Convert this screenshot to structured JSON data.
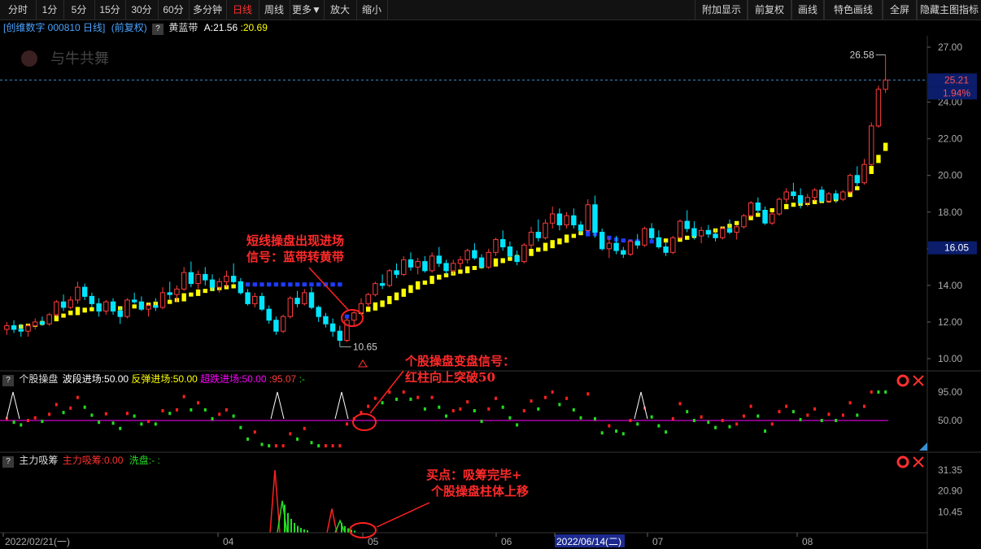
{
  "toolbar": {
    "items": [
      "分时",
      "1分",
      "5分",
      "15分",
      "30分",
      "60分",
      "多分钟",
      "日线",
      "周线",
      "更多▼",
      "放大",
      "缩小"
    ],
    "active": "日线",
    "right": [
      "附加显示",
      "前复权",
      "画线",
      "特色画线",
      "全屏",
      "隐藏主图指标"
    ]
  },
  "header": {
    "stock": "[创维数字 000810 日线]",
    "adj": "(前复权)",
    "q": "?",
    "indicator": "黄蓝带",
    "a_label": "A:21.56",
    "a2": ":20.69"
  },
  "logo": "与牛共舞",
  "main_axis": [
    "27.00",
    "24.00",
    "22.00",
    "20.00",
    "18.00",
    "16.00",
    "14.00",
    "12.00",
    "10.00"
  ],
  "price_tags": {
    "last": "25.21",
    "pct": "1.94%",
    "cross": "16.05",
    "high": "26.58",
    "low": "10.65"
  },
  "sub1": {
    "q": "?",
    "name": "个股操盘",
    "l1": "波段进场:50.00",
    "l2": "反弹进场:50.00",
    "l3": "超跌进场:50.00",
    "l4": ":95.07",
    "l5": ":-",
    "axis": [
      "95.00",
      "50.00"
    ]
  },
  "sub2": {
    "q": "?",
    "name": "主力吸筹",
    "l1": "主力吸筹:0.00",
    "l2": "洗盘:-",
    "l3": ":",
    "axis": [
      "31.35",
      "20.90",
      "10.45"
    ]
  },
  "dates": [
    "2022/02/21(一)",
    "04",
    "05",
    "06",
    "2022/06/14(二)",
    "07",
    "08"
  ],
  "annotations": {
    "a1": [
      "短线操盘出现进场",
      "信号：蓝带转黄带"
    ],
    "a2": [
      "个股操盘变盘信号：",
      "红柱向上突破50"
    ],
    "a3": [
      "买点：吸筹完毕+",
      "个股操盘柱体上移"
    ]
  },
  "colors": {
    "up": "#ff3c3c",
    "down": "#00e5ff",
    "yellow": "#ffff00",
    "blue": "#1f3cff",
    "magenta": "#ff00ff",
    "green": "#22dd22",
    "red": "#ff2020"
  },
  "chart_data": {
    "type": "candlestick",
    "ylim": [
      9.5,
      27.5
    ],
    "ohlc": [
      [
        11.6,
        12.0,
        11.3,
        11.8
      ],
      [
        11.8,
        12.1,
        11.4,
        11.6
      ],
      [
        11.6,
        11.9,
        11.2,
        11.5
      ],
      [
        11.5,
        11.9,
        11.2,
        11.8
      ],
      [
        11.8,
        12.2,
        11.6,
        12.0
      ],
      [
        12.0,
        12.3,
        11.8,
        11.9
      ],
      [
        11.9,
        12.5,
        11.8,
        12.4
      ],
      [
        12.4,
        13.2,
        12.3,
        13.1
      ],
      [
        13.1,
        13.5,
        12.6,
        12.8
      ],
      [
        12.8,
        13.4,
        12.7,
        13.2
      ],
      [
        13.2,
        14.2,
        13.0,
        13.9
      ],
      [
        13.9,
        14.1,
        13.2,
        13.4
      ],
      [
        13.4,
        13.6,
        12.8,
        13.0
      ],
      [
        13.0,
        13.3,
        12.3,
        12.6
      ],
      [
        12.6,
        13.2,
        12.4,
        13.1
      ],
      [
        13.1,
        13.3,
        12.4,
        12.6
      ],
      [
        12.6,
        12.8,
        11.9,
        12.3
      ],
      [
        12.3,
        13.3,
        12.2,
        13.2
      ],
      [
        13.2,
        13.6,
        13.0,
        13.1
      ],
      [
        13.1,
        13.4,
        12.6,
        12.7
      ],
      [
        12.7,
        13.0,
        12.3,
        12.9
      ],
      [
        12.9,
        13.3,
        12.6,
        12.8
      ],
      [
        12.8,
        13.9,
        12.7,
        13.6
      ],
      [
        13.6,
        14.2,
        13.2,
        13.5
      ],
      [
        13.5,
        14.0,
        13.1,
        13.8
      ],
      [
        13.8,
        15.0,
        13.7,
        14.7
      ],
      [
        14.7,
        15.3,
        13.9,
        14.1
      ],
      [
        14.1,
        14.8,
        13.8,
        14.6
      ],
      [
        14.6,
        15.0,
        14.0,
        14.3
      ],
      [
        14.3,
        14.6,
        13.7,
        13.9
      ],
      [
        13.9,
        14.4,
        13.6,
        14.2
      ],
      [
        14.2,
        14.8,
        13.9,
        14.5
      ],
      [
        14.5,
        15.2,
        14.1,
        14.2
      ],
      [
        14.2,
        14.4,
        13.5,
        13.6
      ],
      [
        13.6,
        13.8,
        12.9,
        13.0
      ],
      [
        13.0,
        13.6,
        12.8,
        13.4
      ],
      [
        13.4,
        13.6,
        12.6,
        12.7
      ],
      [
        12.7,
        12.9,
        11.9,
        12.1
      ],
      [
        12.1,
        12.3,
        11.3,
        11.5
      ],
      [
        11.5,
        12.4,
        11.4,
        12.3
      ],
      [
        12.3,
        13.4,
        12.2,
        13.3
      ],
      [
        13.3,
        13.7,
        12.8,
        13.0
      ],
      [
        13.0,
        13.8,
        12.9,
        13.6
      ],
      [
        13.6,
        13.9,
        12.7,
        12.8
      ],
      [
        12.8,
        12.9,
        12.0,
        12.3
      ],
      [
        12.3,
        12.5,
        11.7,
        11.9
      ],
      [
        11.9,
        12.2,
        11.2,
        11.5
      ],
      [
        11.5,
        11.8,
        10.65,
        11.0
      ],
      [
        11.0,
        12.2,
        10.9,
        12.1
      ],
      [
        12.1,
        12.6,
        11.8,
        12.5
      ],
      [
        12.5,
        13.3,
        12.4,
        13.0
      ],
      [
        13.0,
        13.6,
        12.8,
        13.5
      ],
      [
        13.5,
        14.2,
        13.4,
        14.1
      ],
      [
        14.1,
        14.6,
        13.8,
        14.0
      ],
      [
        14.0,
        14.9,
        13.9,
        14.8
      ],
      [
        14.8,
        15.2,
        14.4,
        14.6
      ],
      [
        14.6,
        15.6,
        14.5,
        15.4
      ],
      [
        15.4,
        15.8,
        14.8,
        15.0
      ],
      [
        15.0,
        15.5,
        14.6,
        15.3
      ],
      [
        15.3,
        15.6,
        14.7,
        14.8
      ],
      [
        14.8,
        15.8,
        14.7,
        15.6
      ],
      [
        15.6,
        16.1,
        15.0,
        15.2
      ],
      [
        15.2,
        15.4,
        14.6,
        14.8
      ],
      [
        14.8,
        15.4,
        14.6,
        15.2
      ],
      [
        15.2,
        15.6,
        14.9,
        15.4
      ],
      [
        15.4,
        16.0,
        15.2,
        15.9
      ],
      [
        15.9,
        16.3,
        15.4,
        15.5
      ],
      [
        15.5,
        15.7,
        14.9,
        15.0
      ],
      [
        15.0,
        16.0,
        14.9,
        15.8
      ],
      [
        15.8,
        16.6,
        15.6,
        16.5
      ],
      [
        16.5,
        17.0,
        15.9,
        16.1
      ],
      [
        16.1,
        16.4,
        15.5,
        15.6
      ],
      [
        15.6,
        15.9,
        15.1,
        15.3
      ],
      [
        15.3,
        16.3,
        15.2,
        16.2
      ],
      [
        16.2,
        17.2,
        16.0,
        16.9
      ],
      [
        16.9,
        17.6,
        16.4,
        16.6
      ],
      [
        16.6,
        17.6,
        16.5,
        17.4
      ],
      [
        17.4,
        18.3,
        17.1,
        17.9
      ],
      [
        17.9,
        18.2,
        17.0,
        17.3
      ],
      [
        17.3,
        18.0,
        17.1,
        17.8
      ],
      [
        17.8,
        18.2,
        17.1,
        17.3
      ],
      [
        17.3,
        17.5,
        16.8,
        17.0
      ],
      [
        17.0,
        18.7,
        16.9,
        18.4
      ],
      [
        18.4,
        18.9,
        16.6,
        16.9
      ],
      [
        16.9,
        17.1,
        15.9,
        16.0
      ],
      [
        16.0,
        16.6,
        15.5,
        16.3
      ],
      [
        16.3,
        16.7,
        15.7,
        15.9
      ],
      [
        15.9,
        16.1,
        15.5,
        15.7
      ],
      [
        15.7,
        16.5,
        15.6,
        16.4
      ],
      [
        16.4,
        16.8,
        16.0,
        16.2
      ],
      [
        16.2,
        17.2,
        16.1,
        17.1
      ],
      [
        17.1,
        17.4,
        16.5,
        16.6
      ],
      [
        16.6,
        17.0,
        16.0,
        16.1
      ],
      [
        16.1,
        16.4,
        15.6,
        15.8
      ],
      [
        15.8,
        16.7,
        15.7,
        16.6
      ],
      [
        16.6,
        17.6,
        16.5,
        17.5
      ],
      [
        17.5,
        18.1,
        16.9,
        17.1
      ],
      [
        17.1,
        17.5,
        16.5,
        16.7
      ],
      [
        16.7,
        17.2,
        16.3,
        17.0
      ],
      [
        17.0,
        17.3,
        16.6,
        16.8
      ],
      [
        16.8,
        17.1,
        16.4,
        16.6
      ],
      [
        16.6,
        17.2,
        16.5,
        17.1
      ],
      [
        17.1,
        17.6,
        16.8,
        16.9
      ],
      [
        16.9,
        17.3,
        16.5,
        17.2
      ],
      [
        17.2,
        17.9,
        17.1,
        17.8
      ],
      [
        17.8,
        18.6,
        17.7,
        18.5
      ],
      [
        18.5,
        18.8,
        17.9,
        18.1
      ],
      [
        18.1,
        18.3,
        17.3,
        17.4
      ],
      [
        17.4,
        18.0,
        17.3,
        17.9
      ],
      [
        17.9,
        18.8,
        17.8,
        18.7
      ],
      [
        18.7,
        19.3,
        18.5,
        19.1
      ],
      [
        19.1,
        19.6,
        18.7,
        18.9
      ],
      [
        18.9,
        19.3,
        18.2,
        18.5
      ],
      [
        18.5,
        19.0,
        18.3,
        18.8
      ],
      [
        18.8,
        19.3,
        18.6,
        19.2
      ],
      [
        19.2,
        19.4,
        18.5,
        18.6
      ],
      [
        18.6,
        19.1,
        18.5,
        19.0
      ],
      [
        19.0,
        19.2,
        18.5,
        18.7
      ],
      [
        18.7,
        19.2,
        18.6,
        19.1
      ],
      [
        19.1,
        20.1,
        19.0,
        20.0
      ],
      [
        20.0,
        20.5,
        19.4,
        19.6
      ],
      [
        19.6,
        20.9,
        19.5,
        20.6
      ],
      [
        20.6,
        22.9,
        20.5,
        22.7
      ],
      [
        22.7,
        24.9,
        22.6,
        24.7
      ],
      [
        24.7,
        26.58,
        24.5,
        25.21
      ]
    ],
    "yellow_band": [
      11.7,
      11.7,
      11.75,
      11.8,
      11.85,
      11.95,
      12.05,
      12.2,
      12.35,
      12.5,
      12.6,
      12.65,
      12.7,
      12.7,
      12.72,
      12.75,
      12.75,
      12.8,
      12.85,
      12.9,
      12.95,
      13.0,
      13.05,
      13.1,
      13.2,
      13.35,
      13.5,
      13.6,
      13.7,
      13.8,
      13.85,
      13.9,
      13.95,
      14.0,
      14.05,
      14.05,
      14.05,
      14.05,
      14.05,
      14.05,
      14.05,
      14.05,
      14.05,
      14.05,
      14.05,
      14.05,
      14.05,
      14.05,
      12.3,
      12.4,
      12.55,
      12.7,
      12.85,
      13.0,
      13.2,
      13.4,
      13.6,
      13.8,
      14.0,
      14.15,
      14.3,
      14.45,
      14.55,
      14.65,
      14.75,
      14.85,
      14.95,
      15.05,
      15.15,
      15.25,
      15.35,
      15.45,
      15.55,
      15.65,
      15.8,
      15.95,
      16.1,
      16.25,
      16.4,
      16.55,
      16.7,
      16.85,
      16.9,
      16.8,
      16.7,
      16.6,
      16.5,
      16.45,
      16.4,
      16.4,
      16.4,
      16.4,
      16.4,
      16.45,
      16.5,
      16.55,
      16.6,
      16.7,
      16.8,
      16.9,
      17.0,
      17.1,
      17.25,
      17.4,
      17.55,
      17.7,
      17.85,
      18.0,
      18.1,
      18.2,
      18.3,
      18.4,
      18.45,
      18.5,
      18.55,
      18.6,
      18.65,
      18.7,
      18.8,
      19.0,
      19.3,
      19.8,
      20.3,
      20.9,
      21.56
    ],
    "blue_segments": [
      [
        33,
        48
      ],
      [
        82,
        91
      ]
    ]
  }
}
